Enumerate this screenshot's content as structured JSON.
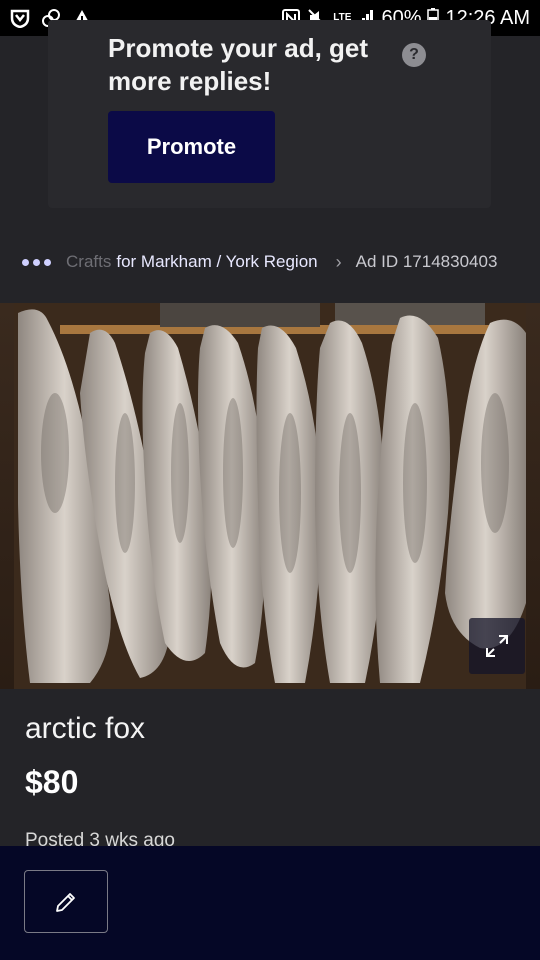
{
  "status_bar": {
    "battery": "60%",
    "time": "12:26 AM",
    "network": "LTE",
    "icons": [
      "shield-app-icon",
      "link-icon",
      "warning-icon",
      "nfc-icon",
      "mute-icon",
      "lte-icon",
      "signal-icon",
      "battery-icon"
    ]
  },
  "promo": {
    "text": "Promote your ad, get more replies!",
    "help_icon_label": "?",
    "button_label": "Promote"
  },
  "breadcrumb": {
    "faded": "Crafts",
    "location": "for Markham / York Region",
    "ad_id": "Ad ID 1714830403"
  },
  "listing": {
    "title": "arctic fox",
    "price": "$80",
    "posted": "Posted 3 wks ago"
  },
  "colors": {
    "background": "#242428",
    "promote_button": "#0b0a47",
    "bottom_bar": "#050726"
  }
}
